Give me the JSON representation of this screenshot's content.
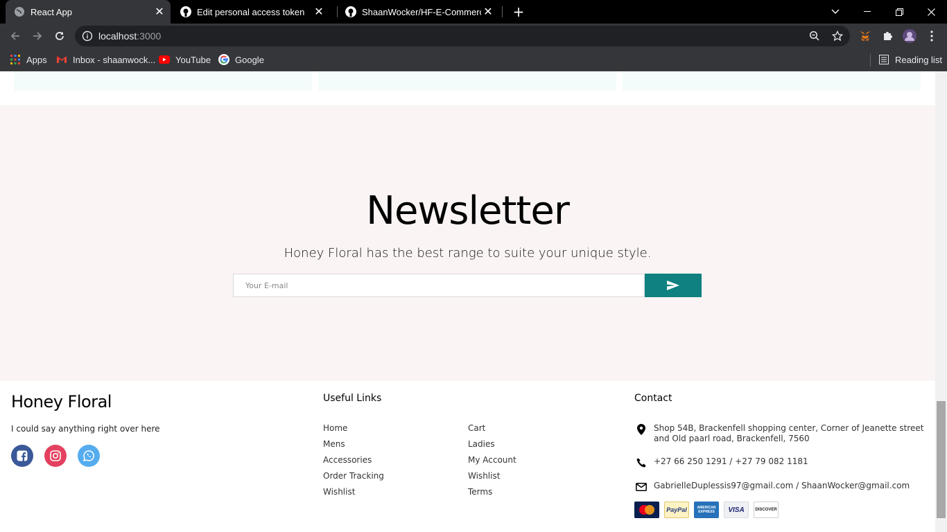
{
  "browser": {
    "tabs": [
      {
        "title": "React App",
        "active": true
      },
      {
        "title": "Edit personal access token",
        "active": false
      },
      {
        "title": "ShaanWocker/HF-E-Commerce: A",
        "active": false
      }
    ],
    "url_host": "localhost",
    "url_port": ":3000",
    "bookmarks": [
      {
        "label": "Apps",
        "icon": "apps-grid-icon"
      },
      {
        "label": "Inbox - shaanwock...",
        "icon": "gmail-icon"
      },
      {
        "label": "YouTube",
        "icon": "youtube-icon"
      },
      {
        "label": "Google",
        "icon": "google-icon"
      }
    ],
    "reading_list": "Reading list"
  },
  "newsletter": {
    "title": "Newsletter",
    "description": "Honey Floral has the best range to suite your unique style.",
    "email_placeholder": "Your E-mail",
    "colors": {
      "background": "#fbf4f4",
      "button": "#0e8180"
    }
  },
  "footer": {
    "brand": "Honey Floral",
    "tagline": "I could say anything right over here",
    "social": [
      {
        "name": "facebook",
        "color": "#3b5998"
      },
      {
        "name": "instagram",
        "color": "#e4405f"
      },
      {
        "name": "whatsapp",
        "color": "#55acee"
      }
    ],
    "useful_links_title": "Useful Links",
    "links_col1": [
      "Home",
      "Mens",
      "Accessories",
      "Order Tracking",
      "Wishlist"
    ],
    "links_col2": [
      "Cart",
      "Ladies",
      "My Account",
      "Wishlist",
      "Terms"
    ],
    "contact_title": "Contact",
    "address": "Shop 54B, Brackenfell shopping center, Corner of Jeanette street and Old paarl road, Brackenfell, 7560",
    "phone": "+27 66 250 1291 / +27 79 082 1181",
    "email": "GabrielleDuplessis97@gmail.com / ShaanWocker@gmail.com",
    "payments": [
      "MasterCard",
      "PayPal",
      "AMERICAN EXPRESS",
      "VISA",
      "DISCOVER"
    ]
  }
}
